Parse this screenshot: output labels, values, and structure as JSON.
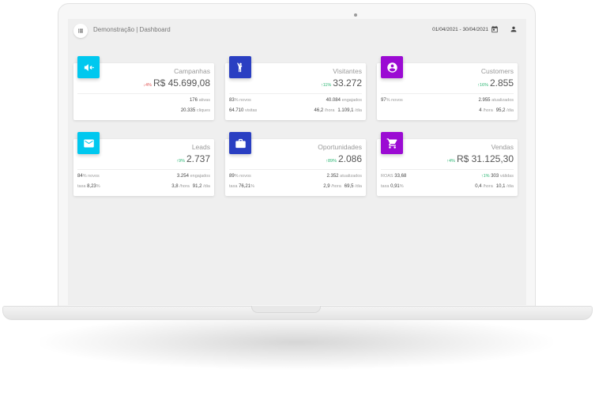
{
  "header": {
    "title": "Demonstração | Dashboard",
    "date_range": "01/04/2021 - 30/04/2021"
  },
  "colors": {
    "cyan": "#00c8ef",
    "blue": "#2a3fc2",
    "purple": "#9b0bd3",
    "up": "#2bb673",
    "down": "#e05353"
  },
  "cards": {
    "campanhas": {
      "icon": "megaphone-icon",
      "title": "Campanhas",
      "trend": "4%",
      "value": "R$ 45.699,08",
      "ativas_value": "176",
      "ativas_label": "ativas",
      "cliques_value": "20.335",
      "cliques_label": "cliques"
    },
    "visitantes": {
      "icon": "person-waving-icon",
      "title": "Visitantes",
      "trend": "11%",
      "value": "33.272",
      "novos_value": "83",
      "novos_label": "% novos",
      "engajados_value": "40.084",
      "engajados_label": "engajados",
      "visitas_value": "64.710",
      "visitas_label": "visitas",
      "hora_value": "46,2",
      "hora_label": "/hora",
      "dia_value": "1.109,1",
      "dia_label": "/dia"
    },
    "customers": {
      "icon": "account-circle-icon",
      "title": "Customers",
      "trend": "16%",
      "value": "2.855",
      "novos_value": "97",
      "novos_label": "% novos",
      "atualizados_value": "2.955",
      "atualizados_label": "atualizados",
      "hora_value": "4",
      "hora_label": "/hora",
      "dia_value": "95,2",
      "dia_label": "/dia"
    },
    "leads": {
      "icon": "email-icon",
      "title": "Leads",
      "trend": "9%",
      "value": "2.737",
      "novos_value": "84",
      "novos_label": "% novos",
      "engajados_value": "3.254",
      "engajados_label": "engajados",
      "taxa_label": "taxa",
      "taxa_value": "8,23",
      "taxa_unit": "%",
      "hora_value": "3,8",
      "hora_label": "/hora",
      "dia_value": "91,2",
      "dia_label": "/dia"
    },
    "oportunidades": {
      "icon": "briefcase-icon",
      "title": "Oportunidades",
      "trend": "89%",
      "value": "2.086",
      "novos_value": "89",
      "novos_label": "% novos",
      "atualizados_value": "2.352",
      "atualizados_label": "atualizados",
      "taxa_label": "taxa",
      "taxa_value": "76,21",
      "taxa_unit": "%",
      "hora_value": "2,9",
      "hora_label": "/hora",
      "dia_value": "69,5",
      "dia_label": "/dia"
    },
    "vendas": {
      "icon": "shopping-cart-icon",
      "title": "Vendas",
      "trend": "4%",
      "value": "R$ 31.125,30",
      "roas_label": "ROAS",
      "roas_value": "33,68",
      "validas_trend": "1%",
      "validas_value": "303",
      "validas_label": "válidas",
      "taxa_label": "taxa",
      "taxa_value": "0,91",
      "taxa_unit": "%",
      "hora_value": "0,4",
      "hora_label": "/hora",
      "dia_value": "10,1",
      "dia_label": "/dia"
    }
  }
}
